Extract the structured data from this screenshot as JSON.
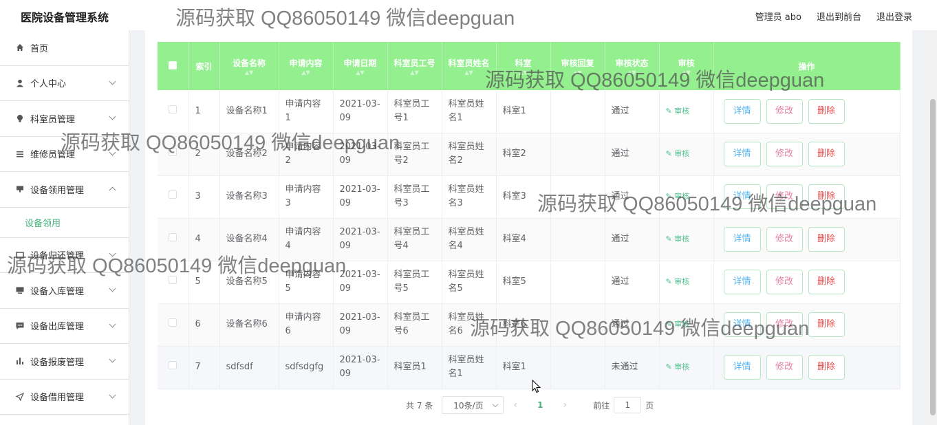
{
  "app": {
    "title": "医院设备管理系统"
  },
  "header": {
    "user": "管理员 abo",
    "back_link": "退出到前台",
    "logout": "退出登录"
  },
  "watermark": "源码获取 QQ86050149 微信deepguan",
  "sidebar": {
    "items": [
      {
        "label": "首页",
        "icon": "home-icon"
      },
      {
        "label": "个人中心",
        "icon": "user-icon"
      },
      {
        "label": "科室员管理",
        "icon": "bulb-icon"
      },
      {
        "label": "维修员管理",
        "icon": "list-icon"
      },
      {
        "label": "设备领用管理",
        "icon": "device-icon"
      },
      {
        "label": "设备领用",
        "sub": true
      },
      {
        "label": "设备归还管理",
        "icon": "return-icon"
      },
      {
        "label": "设备入库管理",
        "icon": "monitor-icon"
      },
      {
        "label": "设备出库管理",
        "icon": "message-icon"
      },
      {
        "label": "设备报废管理",
        "icon": "chart-icon"
      },
      {
        "label": "设备借用管理",
        "icon": "send-icon"
      }
    ]
  },
  "table": {
    "headers": [
      "",
      "索引",
      "设备名称",
      "申请内容",
      "申请日期",
      "科室员工号",
      "科室员姓名",
      "科室",
      "审核回复",
      "审核状态",
      "审核",
      "操作"
    ],
    "audit_label": "审核",
    "actions": {
      "detail": "详情",
      "edit": "修改",
      "delete": "删除"
    },
    "rows": [
      {
        "index": "1",
        "name": "设备名称1",
        "content": "申请内容1",
        "date": "2021-03-09",
        "staff_no": "科室员工号1",
        "staff_name": "科室员姓名1",
        "dept": "科室1",
        "reply": "",
        "status": "通过"
      },
      {
        "index": "2",
        "name": "设备名称2",
        "content": "申请内容2",
        "date": "2021-03-09",
        "staff_no": "科室员工号2",
        "staff_name": "科室员姓名2",
        "dept": "科室2",
        "reply": "",
        "status": "通过"
      },
      {
        "index": "3",
        "name": "设备名称3",
        "content": "申请内容3",
        "date": "2021-03-09",
        "staff_no": "科室员工号3",
        "staff_name": "科室员姓名3",
        "dept": "科室3",
        "reply": "",
        "status": "通过"
      },
      {
        "index": "4",
        "name": "设备名称4",
        "content": "申请内容4",
        "date": "2021-03-09",
        "staff_no": "科室员工号4",
        "staff_name": "科室员姓名4",
        "dept": "科室4",
        "reply": "",
        "status": "通过"
      },
      {
        "index": "5",
        "name": "设备名称5",
        "content": "申请内容5",
        "date": "2021-03-09",
        "staff_no": "科室员工号5",
        "staff_name": "科室员姓名5",
        "dept": "科室5",
        "reply": "",
        "status": "通过"
      },
      {
        "index": "6",
        "name": "设备名称6",
        "content": "申请内容6",
        "date": "2021-03-09",
        "staff_no": "科室员工号6",
        "staff_name": "科室员姓名6",
        "dept": "科室6",
        "reply": "",
        "status": "通过"
      },
      {
        "index": "7",
        "name": "sdfsdf",
        "content": "sdfsdgfg",
        "date": "2021-03-09",
        "staff_no": "科室员1",
        "staff_name": "科室员姓名1",
        "dept": "科室1",
        "reply": "",
        "status": "未通过"
      }
    ]
  },
  "pagination": {
    "total": "共 7 条",
    "page_size": "10条/页",
    "current": "1",
    "goto_prefix": "前往",
    "goto_value": "1",
    "goto_suffix": "页"
  },
  "colors": {
    "accent": "#44b37a",
    "header_bg": "#94ef8f"
  }
}
